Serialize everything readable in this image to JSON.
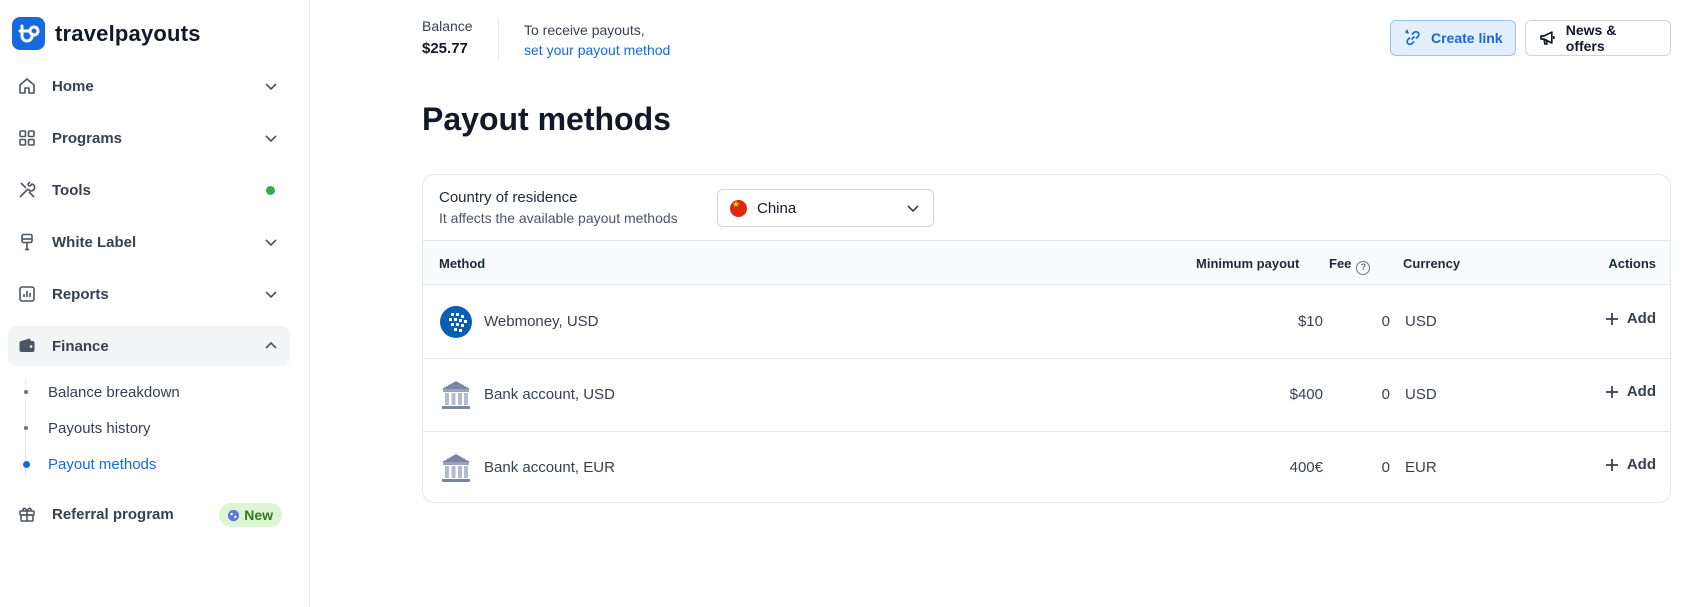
{
  "brand": {
    "name": "travelpayouts",
    "accent": "#1769e0"
  },
  "sidebar": {
    "items": [
      {
        "label": "Home",
        "icon": "home-icon"
      },
      {
        "label": "Programs",
        "icon": "grid-icon"
      },
      {
        "label": "Tools",
        "icon": "tools-icon",
        "status": "green-dot"
      },
      {
        "label": "White Label",
        "icon": "brush-icon"
      },
      {
        "label": "Reports",
        "icon": "chart-icon"
      },
      {
        "label": "Finance",
        "icon": "wallet-icon",
        "expanded": true
      },
      {
        "label": "Referral program",
        "icon": "gift-icon",
        "badge": "New"
      }
    ],
    "finance_sub": [
      {
        "label": "Balance breakdown"
      },
      {
        "label": "Payouts history"
      },
      {
        "label": "Payout methods",
        "active": true
      }
    ]
  },
  "topbar": {
    "balance_label": "Balance",
    "balance_value": "$25.77",
    "payout_note": "To receive payouts,",
    "payout_link": "set your payout method",
    "create_link": "Create link",
    "news_offers": "News & offers"
  },
  "page": {
    "title": "Payout methods"
  },
  "country": {
    "title": "Country of residence",
    "subtitle": "It affects the available payout methods",
    "selected": "China"
  },
  "table": {
    "headers": {
      "method": "Method",
      "min_payout": "Minimum payout",
      "fee": "Fee",
      "currency": "Currency",
      "actions": "Actions"
    },
    "rows": [
      {
        "method": "Webmoney, USD",
        "icon": "webmoney-icon",
        "min_payout": "$10",
        "fee": "0",
        "currency": "USD",
        "action": "Add"
      },
      {
        "method": "Bank account, USD",
        "icon": "bank-icon",
        "min_payout": "$400",
        "fee": "0",
        "currency": "USD",
        "action": "Add"
      },
      {
        "method": "Bank account, EUR",
        "icon": "bank-icon",
        "min_payout": "400€",
        "fee": "0",
        "currency": "EUR",
        "action": "Add"
      }
    ]
  }
}
